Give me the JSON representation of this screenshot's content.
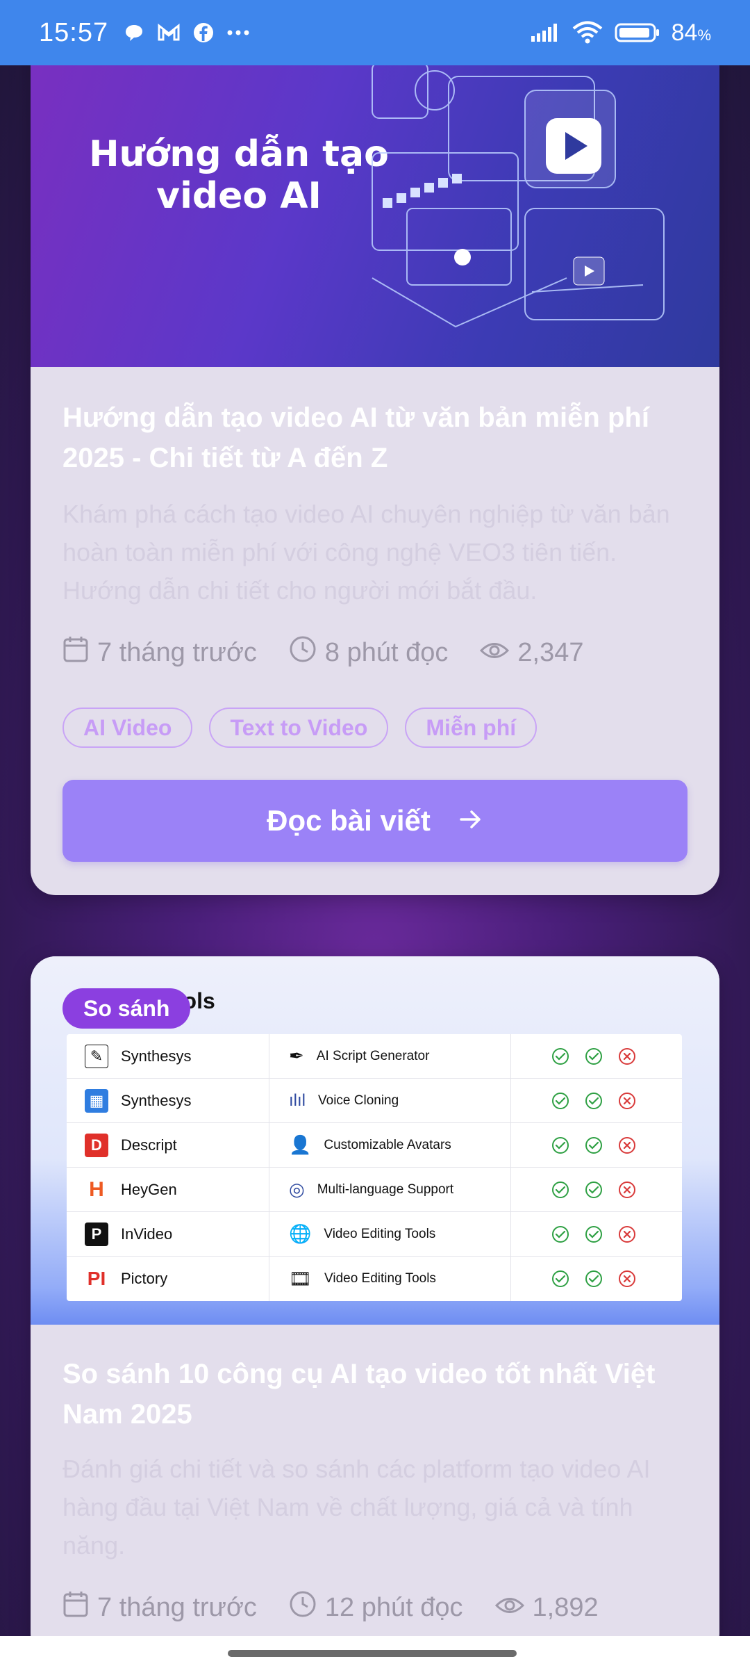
{
  "status_bar": {
    "time": "15:57",
    "battery": "84",
    "battery_unit": "%"
  },
  "articles": [
    {
      "hero_title": "Hướng dẫn tạo video AI",
      "title": "Hướng dẫn tạo video AI từ văn bản miễn phí 2025 - Chi tiết từ A đến Z",
      "description": "Khám phá cách tạo video AI chuyên nghiệp từ văn bản hoàn toàn miễn phí với công nghệ VEO3 tiên tiến. Hướng dẫn chi tiết cho người mới bắt đầu.",
      "date": "7 tháng trước",
      "read_time": "8 phút đọc",
      "views": "2,347",
      "tags": [
        "AI Video",
        "Text to Video",
        "Miễn phí"
      ],
      "cta": "Đọc bài viết"
    },
    {
      "badge": "So sánh",
      "hero_header": "ools",
      "tools": [
        {
          "name": "Synthesys",
          "feature": "AI Script Generator",
          "logo_color": "#ffffff",
          "checks": [
            "yes",
            "yes",
            "no"
          ]
        },
        {
          "name": "Synthesys",
          "feature": "Voice Cloning",
          "logo_color": "#2f7de0",
          "checks": [
            "yes",
            "yes",
            "no"
          ]
        },
        {
          "name": "Descript",
          "feature": "Customizable Avatars",
          "logo_color": "#e0302a",
          "checks": [
            "yes",
            "yes",
            "no"
          ]
        },
        {
          "name": "HeyGen",
          "feature": "Multi-language Support",
          "logo_color": "#ee5a22",
          "checks": [
            "yes",
            "yes",
            "no"
          ]
        },
        {
          "name": "InVideo",
          "feature": "Video Editing Tools",
          "logo_color": "#111111",
          "checks": [
            "yes",
            "yes",
            "no"
          ]
        },
        {
          "name": "Pictory",
          "feature": "Video Editing Tools",
          "logo_color": "#e0302a",
          "checks": [
            "yes",
            "yes",
            "no"
          ]
        }
      ],
      "title": "So sánh 10 công cụ AI tạo video tốt nhất Việt Nam 2025",
      "description": "Đánh giá chi tiết và so sánh các platform tạo video AI hàng đầu tại Việt Nam về chất lượng, giá cả và tính năng.",
      "date": "7 tháng trước",
      "read_time": "12 phút đọc",
      "views": "1,892"
    }
  ],
  "colors": {
    "status_bar": "#3f86ec",
    "accent_purple": "#8b3fe0",
    "button": "#9b82f7",
    "check_green": "#2ea043",
    "cross_red": "#d93a3a"
  }
}
